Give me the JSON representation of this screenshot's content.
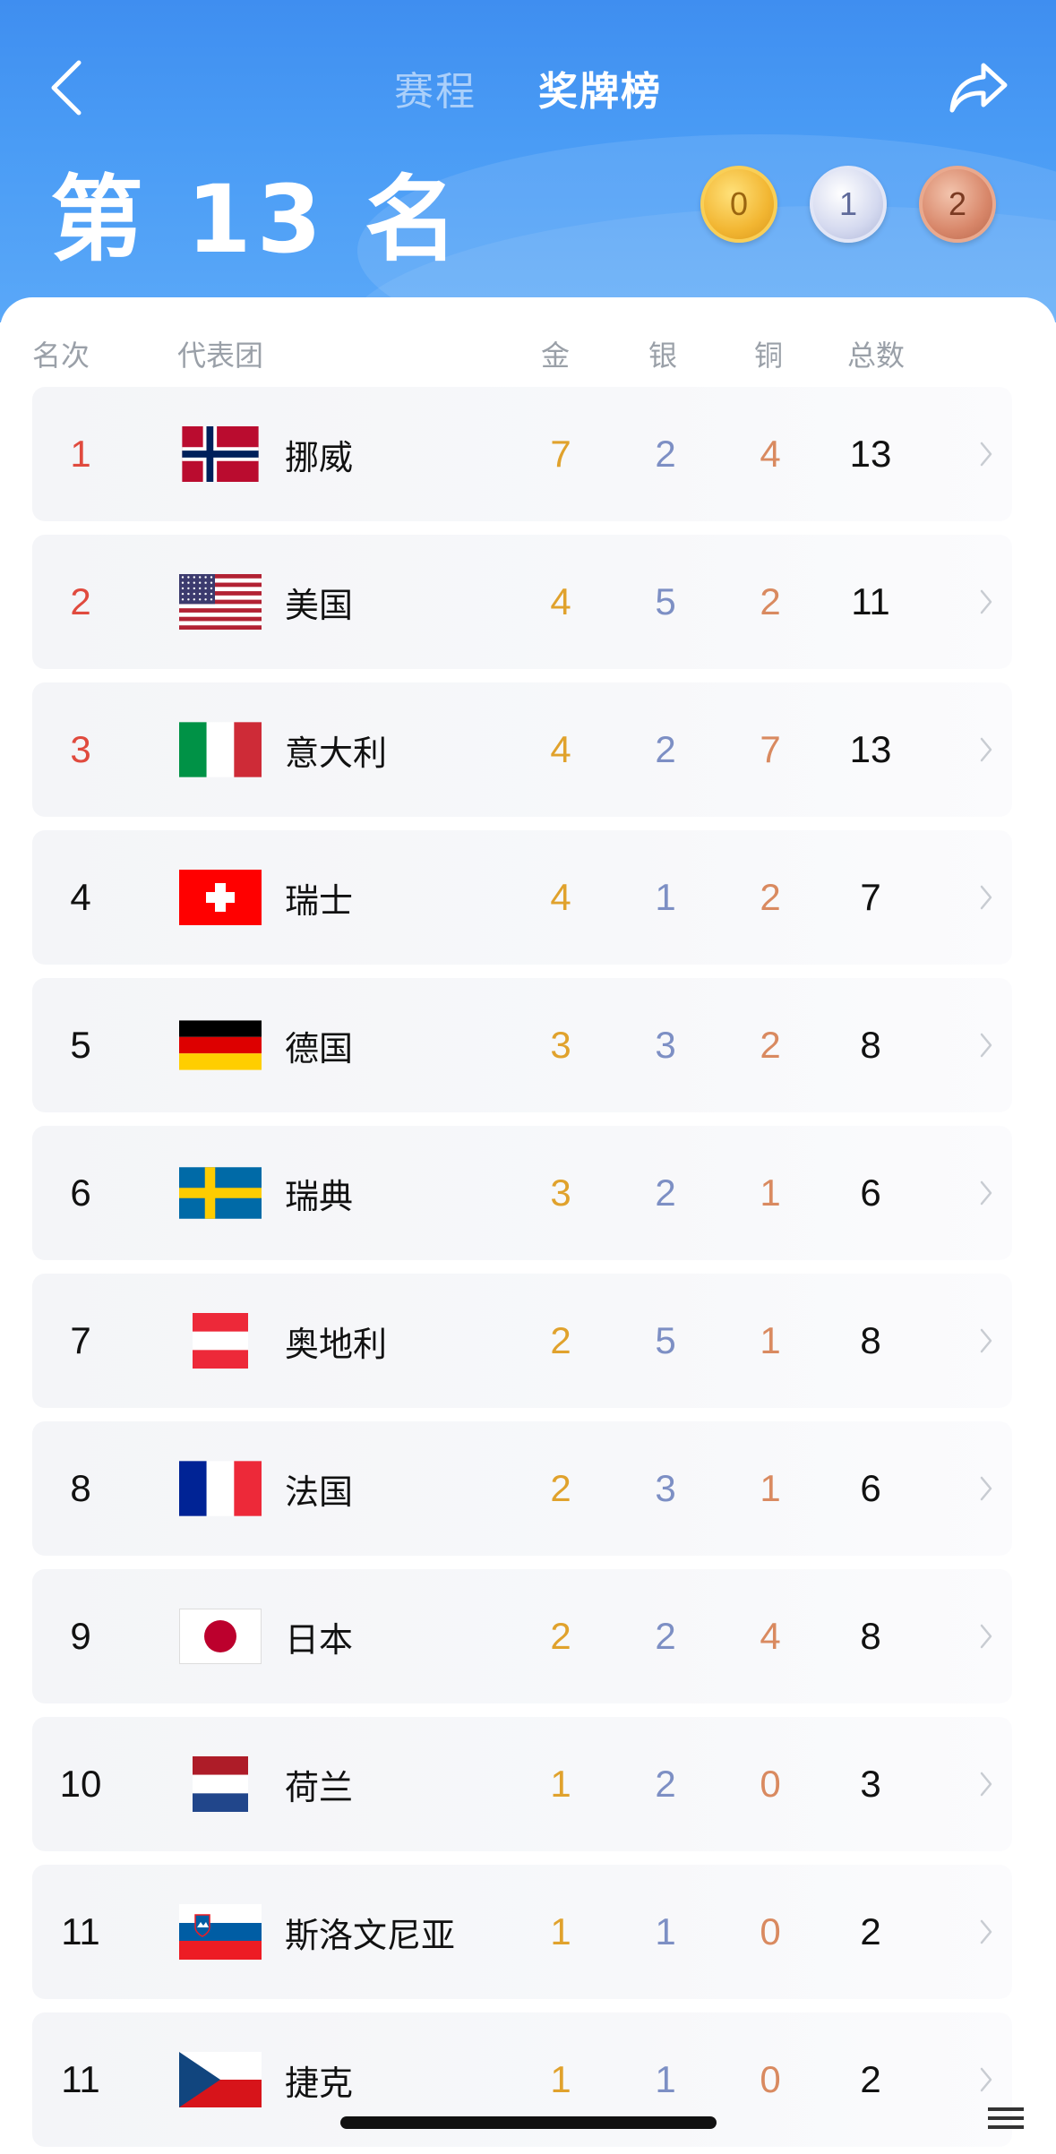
{
  "header": {
    "tabs": [
      {
        "label": "赛程",
        "active": false
      },
      {
        "label": "奖牌榜",
        "active": true
      }
    ],
    "rank_title": "第 13 名",
    "own_medals": {
      "gold": "0",
      "silver": "1",
      "bronze": "2"
    }
  },
  "columns": {
    "rank": "名次",
    "team": "代表团",
    "gold": "金",
    "silver": "银",
    "bronze": "铜",
    "total": "总数"
  },
  "rows": [
    {
      "rank": "1",
      "country": "挪威",
      "flag": "norway-flag-icon",
      "gold": "7",
      "silver": "2",
      "bronze": "4",
      "total": "13"
    },
    {
      "rank": "2",
      "country": "美国",
      "flag": "usa-flag-icon",
      "gold": "4",
      "silver": "5",
      "bronze": "2",
      "total": "11"
    },
    {
      "rank": "3",
      "country": "意大利",
      "flag": "italy-flag-icon",
      "gold": "4",
      "silver": "2",
      "bronze": "7",
      "total": "13"
    },
    {
      "rank": "4",
      "country": "瑞士",
      "flag": "switzerland-flag-icon",
      "gold": "4",
      "silver": "1",
      "bronze": "2",
      "total": "7"
    },
    {
      "rank": "5",
      "country": "德国",
      "flag": "germany-flag-icon",
      "gold": "3",
      "silver": "3",
      "bronze": "2",
      "total": "8"
    },
    {
      "rank": "6",
      "country": "瑞典",
      "flag": "sweden-flag-icon",
      "gold": "3",
      "silver": "2",
      "bronze": "1",
      "total": "6"
    },
    {
      "rank": "7",
      "country": "奥地利",
      "flag": "austria-flag-icon",
      "gold": "2",
      "silver": "5",
      "bronze": "1",
      "total": "8"
    },
    {
      "rank": "8",
      "country": "法国",
      "flag": "france-flag-icon",
      "gold": "2",
      "silver": "3",
      "bronze": "1",
      "total": "6"
    },
    {
      "rank": "9",
      "country": "日本",
      "flag": "japan-flag-icon",
      "gold": "2",
      "silver": "2",
      "bronze": "4",
      "total": "8"
    },
    {
      "rank": "10",
      "country": "荷兰",
      "flag": "netherlands-flag-icon",
      "gold": "1",
      "silver": "2",
      "bronze": "0",
      "total": "3"
    },
    {
      "rank": "11",
      "country": "斯洛文尼亚",
      "flag": "slovenia-flag-icon",
      "gold": "1",
      "silver": "1",
      "bronze": "0",
      "total": "2"
    },
    {
      "rank": "11",
      "country": "捷克",
      "flag": "czech-flag-icon",
      "gold": "1",
      "silver": "1",
      "bronze": "0",
      "total": "2"
    }
  ],
  "colors": {
    "header_blue": "#4a9cf5",
    "top_rank_red": "#e04a3e",
    "gold_text": "#e0a22c",
    "silver_text": "#7d8fc4",
    "bronze_text": "#d98a60"
  }
}
